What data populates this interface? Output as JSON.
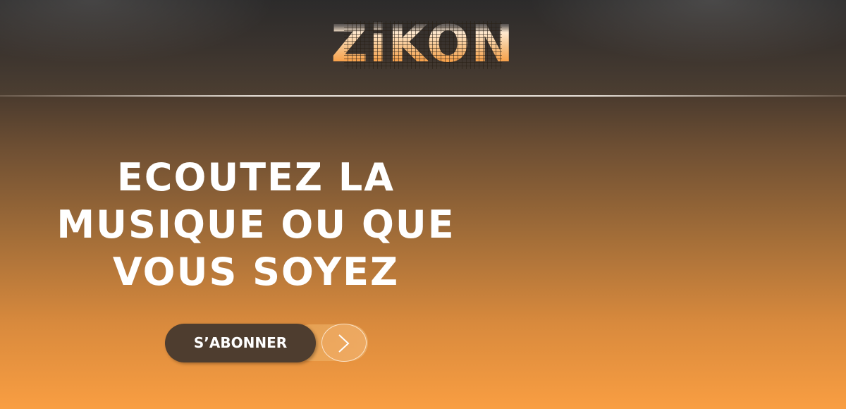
{
  "header": {
    "logo": "ZiKON"
  },
  "hero": {
    "headline_lines": [
      "ECOUTEZ LA",
      "MUSIQUE OU QUE",
      "VOUS SOYEZ"
    ],
    "cta_label": "S’ABONNER",
    "cta_icon": "chevron-right-icon"
  },
  "colors": {
    "accent": "#f89c40",
    "button": "#4e3d2f",
    "header": "#2c2b2b"
  }
}
